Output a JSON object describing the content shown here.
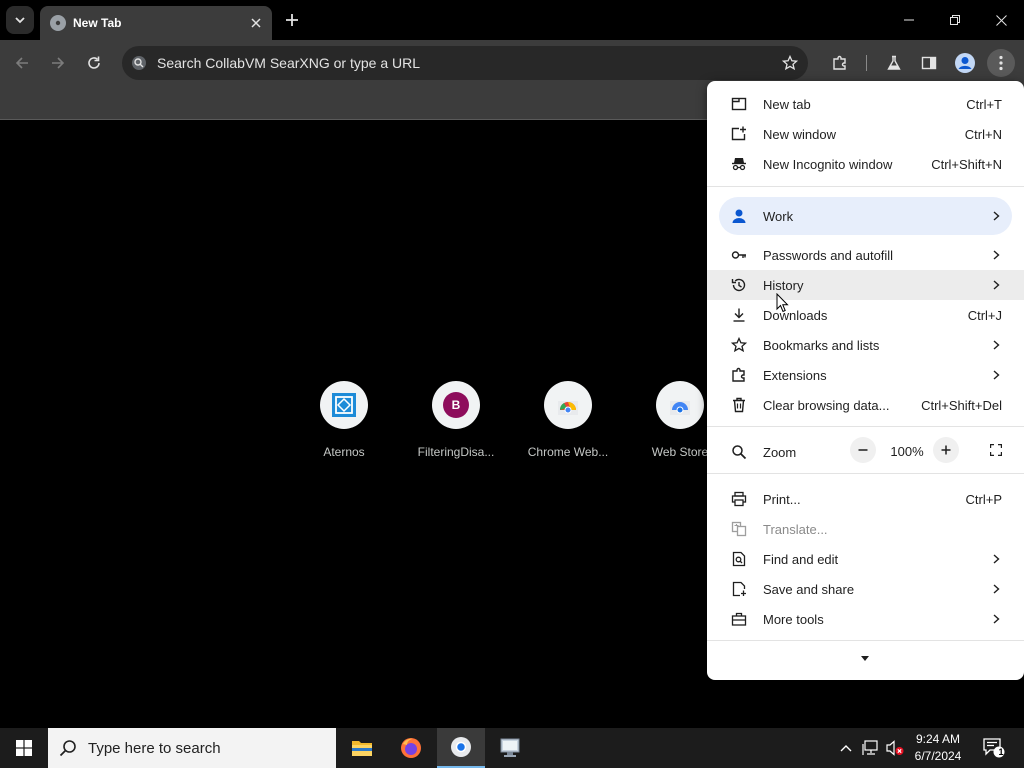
{
  "tab": {
    "title": "New Tab"
  },
  "omnibox": {
    "placeholder": "Search CollabVM SearXNG or type a URL"
  },
  "shortcuts": [
    {
      "label": "Aternos"
    },
    {
      "label": "FilteringDisa...",
      "letter": "B"
    },
    {
      "label": "Chrome Web..."
    },
    {
      "label": "Web Store"
    }
  ],
  "menu": {
    "new_tab": {
      "label": "New tab",
      "shortcut": "Ctrl+T"
    },
    "new_window": {
      "label": "New window",
      "shortcut": "Ctrl+N"
    },
    "new_incognito": {
      "label": "New Incognito window",
      "shortcut": "Ctrl+Shift+N"
    },
    "profile": {
      "label": "Work"
    },
    "passwords": {
      "label": "Passwords and autofill"
    },
    "history": {
      "label": "History"
    },
    "downloads": {
      "label": "Downloads",
      "shortcut": "Ctrl+J"
    },
    "bookmarks": {
      "label": "Bookmarks and lists"
    },
    "extensions": {
      "label": "Extensions"
    },
    "clear_data": {
      "label": "Clear browsing data...",
      "shortcut": "Ctrl+Shift+Del"
    },
    "zoom": {
      "label": "Zoom",
      "value": "100%"
    },
    "print": {
      "label": "Print...",
      "shortcut": "Ctrl+P"
    },
    "translate": {
      "label": "Translate..."
    },
    "find_edit": {
      "label": "Find and edit"
    },
    "save_share": {
      "label": "Save and share"
    },
    "more_tools": {
      "label": "More tools"
    }
  },
  "taskbar": {
    "search_placeholder": "Type here to search",
    "time": "9:24 AM",
    "date": "6/7/2024",
    "notification_count": "1"
  },
  "colors": {
    "menu_bg": "#ffffff",
    "profile_highlight": "#e7eefb",
    "profile_icon": "#0b57d0",
    "toolbar_bg": "#3c3c3c",
    "taskbar_bg": "#1c1c1c"
  }
}
